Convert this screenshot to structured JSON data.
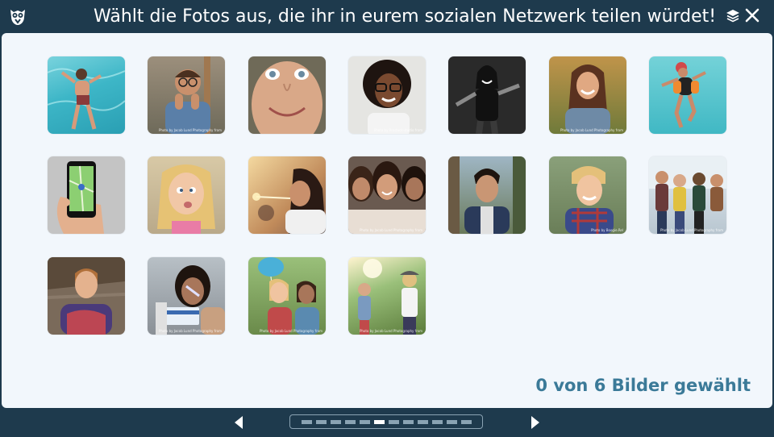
{
  "header": {
    "title": "Wählt die Fotos aus, die ihr in eurem sozialen Netzwerk teilen würdet!",
    "logo_icon": "owl-logo-icon",
    "layers_icon": "layers-icon",
    "close_icon": "close-icon"
  },
  "photos": [
    {
      "subject": "boy swimming underwater in pool",
      "credit": ""
    },
    {
      "subject": "boy with glasses",
      "credit": "Photo by Jacob Lund Photography from"
    },
    {
      "subject": "close-up smiling child face",
      "credit": ""
    },
    {
      "subject": "girl with curly hair and glasses",
      "credit": "Photo by Prostock-studio from"
    },
    {
      "subject": "girl in black and white",
      "credit": ""
    },
    {
      "subject": "smiling girl with long hair outdoors",
      "credit": "Photo by Jacob Lund Photography from"
    },
    {
      "subject": "child jumping into pool",
      "credit": ""
    },
    {
      "subject": "hand holding smartphone with map",
      "credit": ""
    },
    {
      "subject": "blonde girl making a face",
      "credit": ""
    },
    {
      "subject": "girls with sparkler at sunset",
      "credit": ""
    },
    {
      "subject": "group selfie of girls",
      "credit": "Photo by Jacob Lund Photography from"
    },
    {
      "subject": "teenage boy portrait outdoors",
      "credit": ""
    },
    {
      "subject": "blonde smiling boy",
      "credit": "Photo by Boogie.Rel"
    },
    {
      "subject": "group of teens walking",
      "credit": "Photo by Jacob Lund Photography from"
    },
    {
      "subject": "boy in hoodie portrait",
      "credit": ""
    },
    {
      "subject": "girl with face paint holding ticket",
      "credit": "Photo by Jacob Lund Photography from"
    },
    {
      "subject": "girls with balloon eating ice cream",
      "credit": "Photo by Jacob Lund Photography from"
    },
    {
      "subject": "kids playing in park",
      "credit": "Photo by Jacob Lund Photography from"
    }
  ],
  "selection": {
    "count_text": "0 von 6 Bilder gewählt",
    "color": "#3b7a98"
  },
  "footer": {
    "prev_icon": "arrow-left-icon",
    "next_icon": "arrow-right-icon",
    "pages_total": 12,
    "page_current": 6
  },
  "colors": {
    "frame": "#1e3a4d",
    "panel": "#f2f7fc",
    "accent": "#3b7a98"
  }
}
